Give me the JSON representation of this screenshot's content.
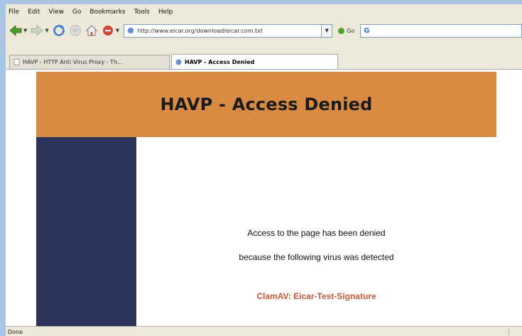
{
  "menu": [
    "File",
    "Edit",
    "View",
    "Go",
    "Bookmarks",
    "Tools",
    "Help"
  ],
  "nav": {
    "icons": [
      "back-arrow-icon",
      "forward-arrow-icon",
      "reload-icon",
      "stop-icon",
      "home-icon",
      "blocked-icon"
    ],
    "address": "http://www.eicar.org/download/eicar.com.txt",
    "go_label": "Go",
    "search_logo": "G"
  },
  "tabs": [
    {
      "label": "HAVP - HTTP Anti Virus Proxy - Th...",
      "active": false
    },
    {
      "label": "HAVP - Access Denied",
      "active": true
    }
  ],
  "page": {
    "title": "HAVP - Access Denied",
    "line1": "Access to the page has been denied",
    "line2": "because the following virus was detected",
    "virus": "ClamAV: Eicar-Test-Signature",
    "colors": {
      "banner": "#d98a43",
      "sidebar": "#2c3459",
      "virus_text": "#c05a3a"
    }
  },
  "status": {
    "text": "Done"
  }
}
